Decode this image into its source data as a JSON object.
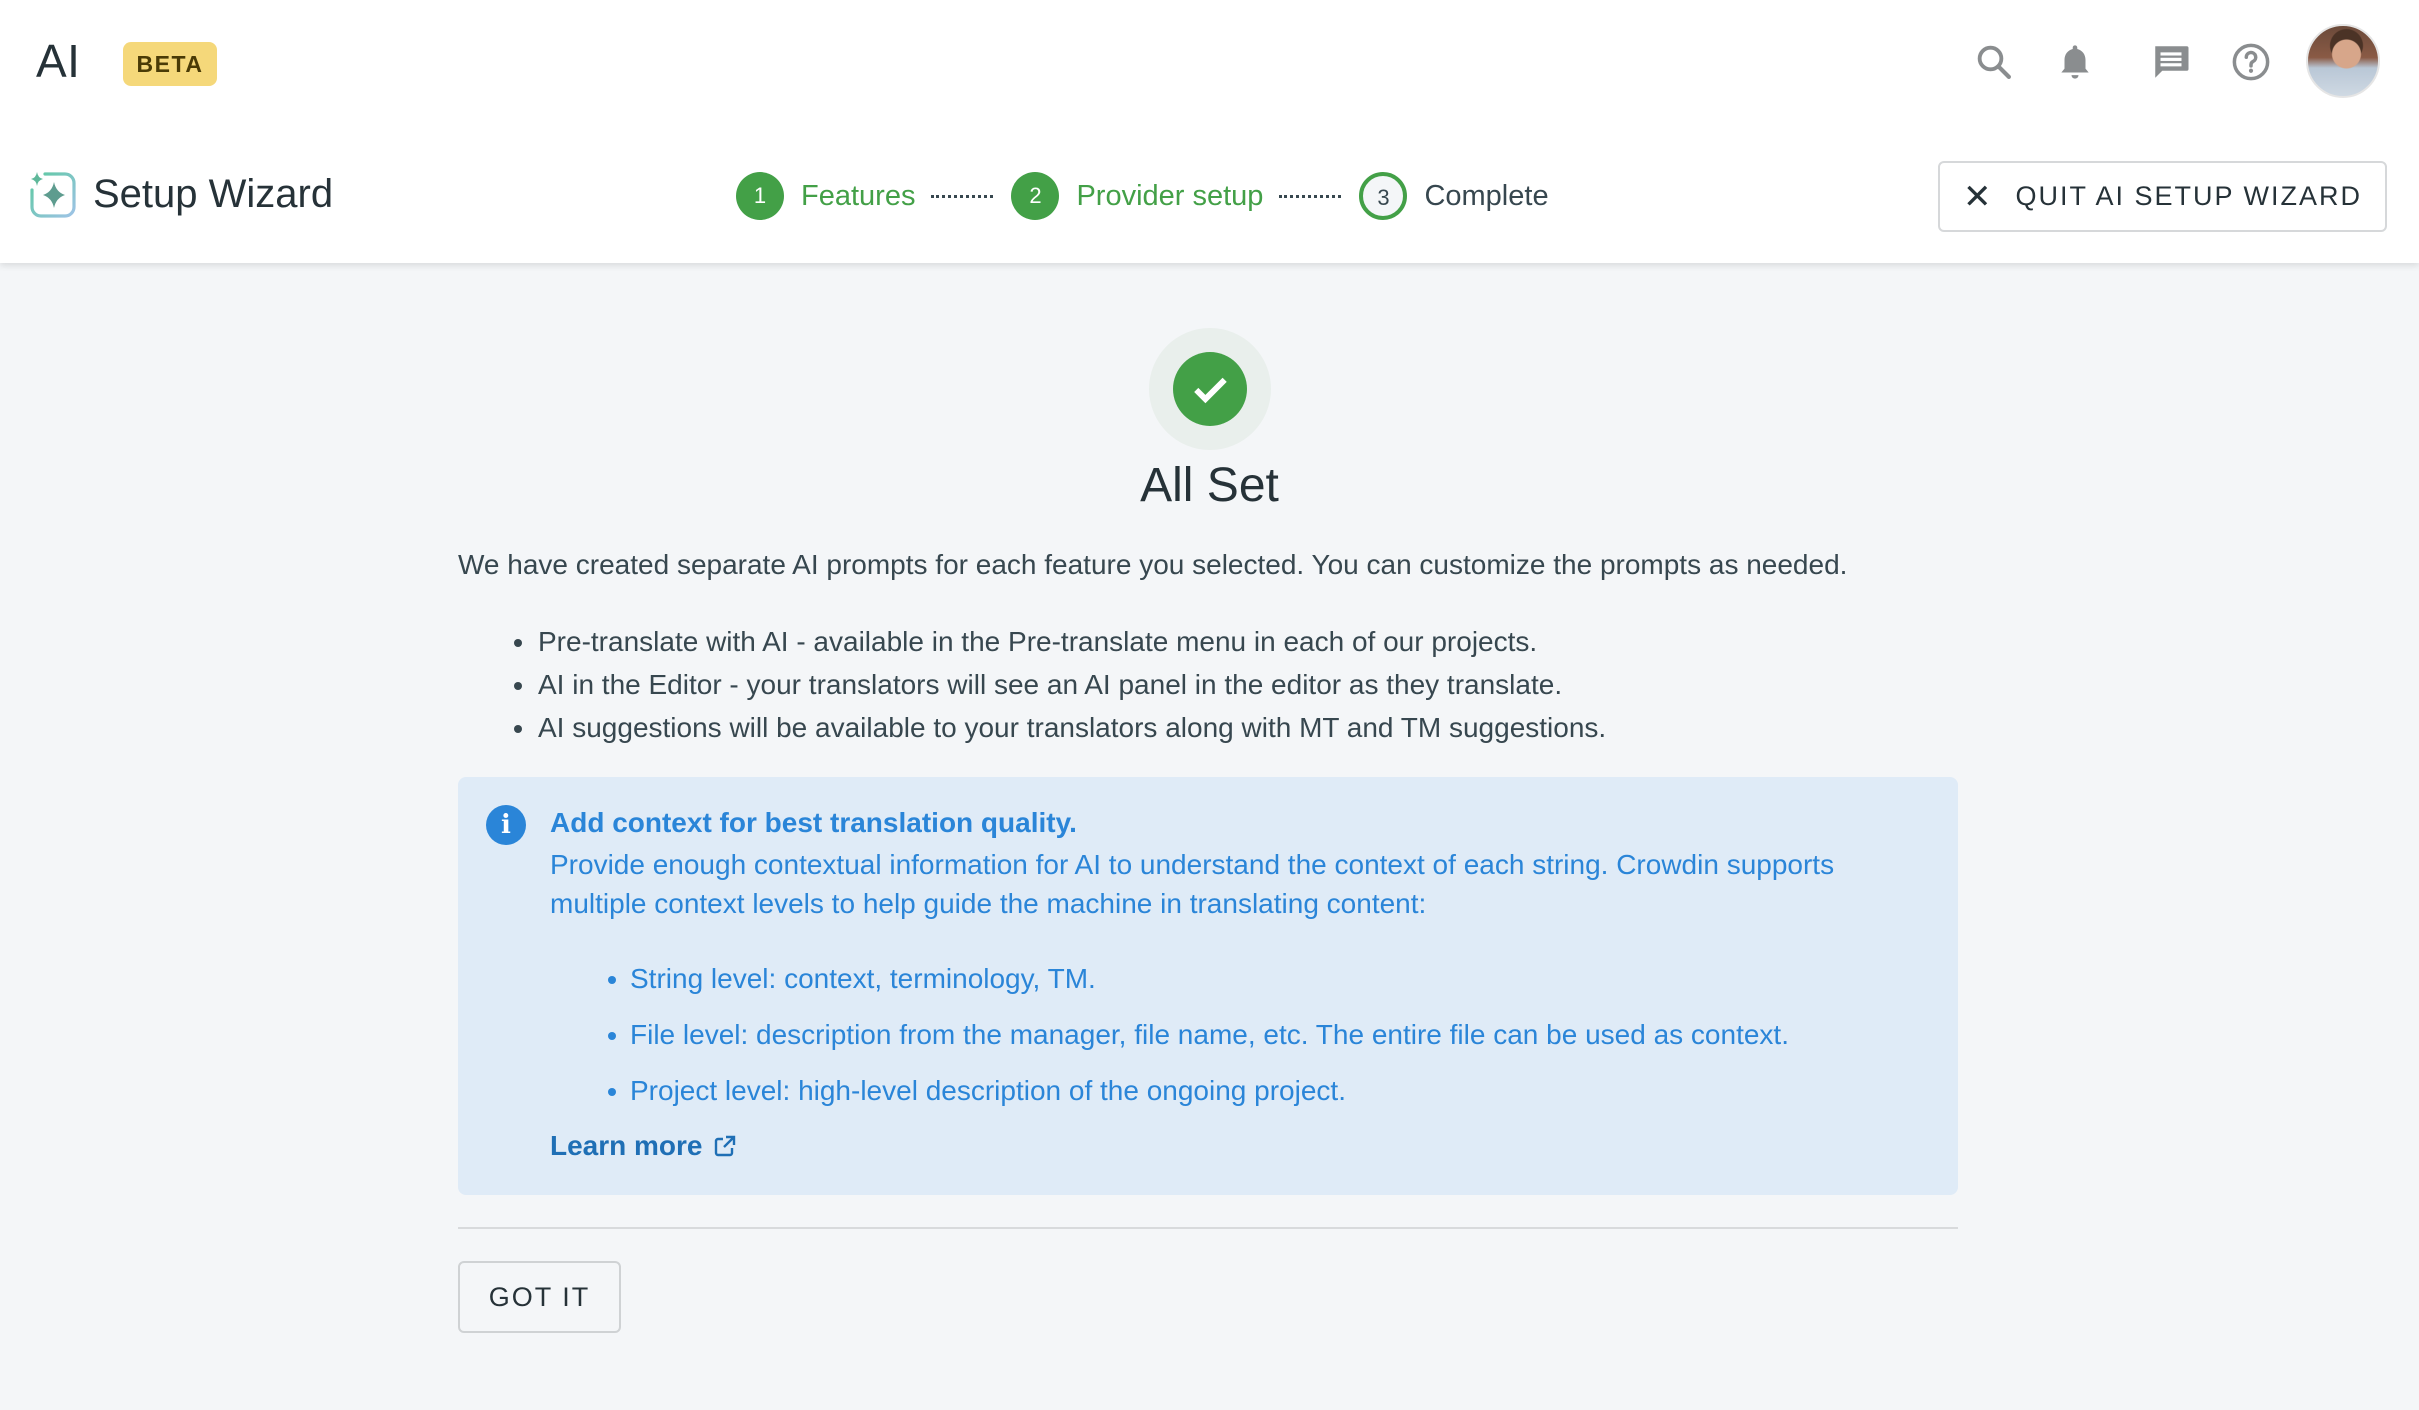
{
  "header": {
    "app_title": "AI",
    "badge": "BETA",
    "icons": [
      "search-icon",
      "bell-icon",
      "chat-icon",
      "help-icon"
    ],
    "avatar": "user-avatar"
  },
  "wizard": {
    "title": "Setup Wizard",
    "steps": [
      {
        "number": "1",
        "label": "Features",
        "state": "done"
      },
      {
        "number": "2",
        "label": "Provider setup",
        "state": "done"
      },
      {
        "number": "3",
        "label": "Complete",
        "state": "current"
      }
    ],
    "quit_label": "QUIT AI SETUP WIZARD"
  },
  "main": {
    "heading": "All Set",
    "intro": "We have created separate AI prompts for each feature you selected. You can customize the prompts as needed.",
    "features": [
      "Pre-translate with AI - available in the Pre-translate menu in each of our projects.",
      "AI in the Editor - your translators will see an AI panel in the editor as they translate.",
      "AI suggestions will be available to your translators along with MT and TM suggestions."
    ],
    "info": {
      "title": "Add context for best translation quality.",
      "body": "Provide enough contextual information for AI to understand the context of each string. Crowdin supports multiple context levels to help guide the machine in translating content:",
      "levels": [
        "String level: context, terminology, TM.",
        "File level: description from the manager, file name, etc. The entire file can be used as context.",
        "Project level: high-level description of the ongoing project."
      ],
      "learn_more": "Learn more"
    },
    "got_it_label": "GOT IT"
  },
  "colors": {
    "accent_green": "#43a047",
    "info_blue": "#2a85d8",
    "info_bg": "#dfebf7",
    "beta_bg": "#f5d87a"
  }
}
